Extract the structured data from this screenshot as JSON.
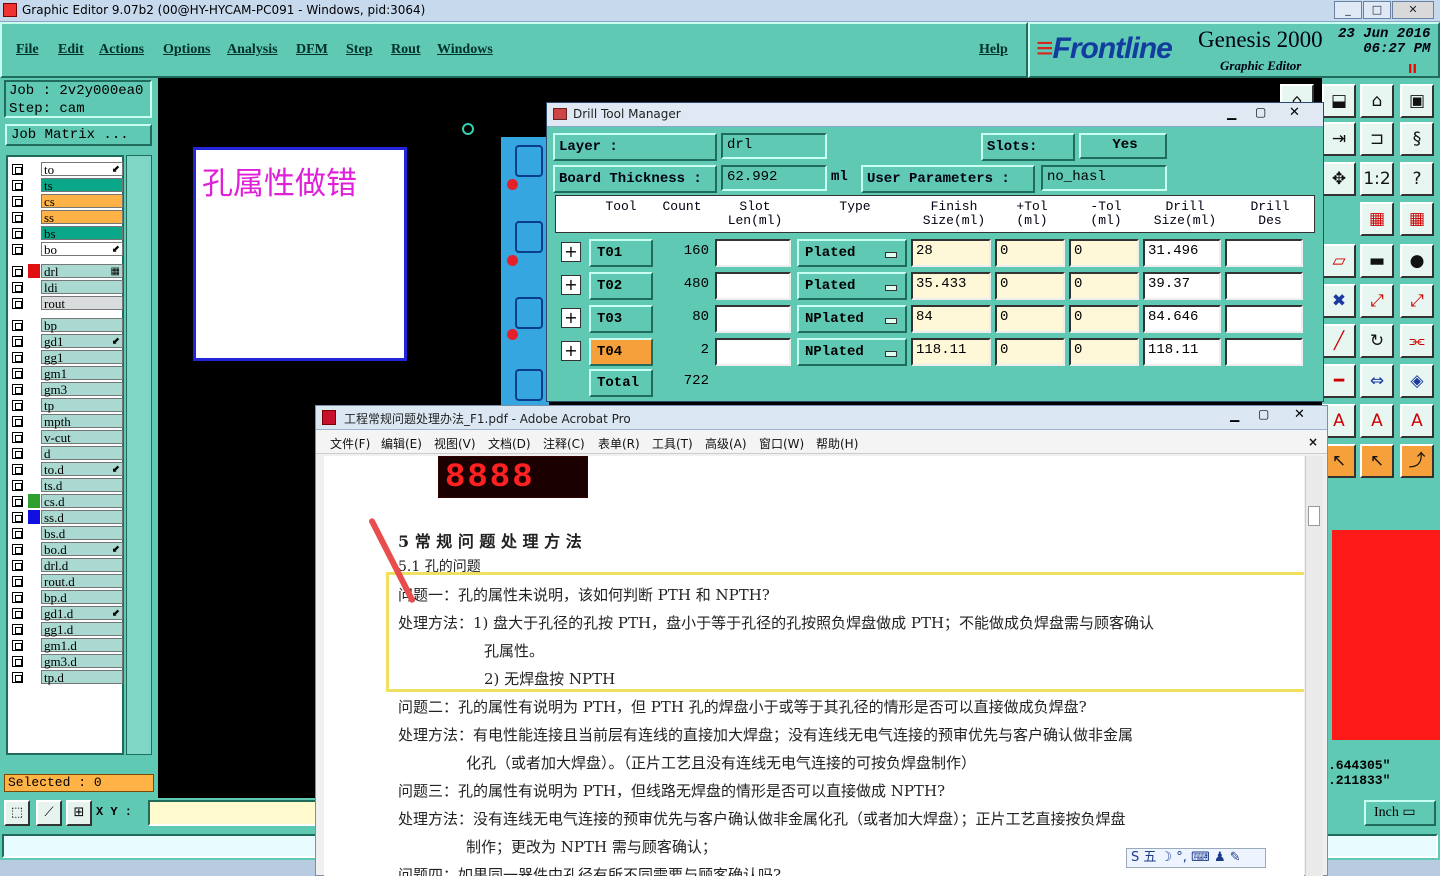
{
  "window": {
    "title": "Graphic Editor 9.07b2 (00@HY-HYCAM-PC091 - Windows, pid:3064)",
    "controls": [
      "_",
      "□",
      "✕"
    ]
  },
  "menu": [
    "File",
    "Edit",
    "Actions",
    "Options",
    "Analysis",
    "DFM",
    "Step",
    "Rout",
    "Windows"
  ],
  "help_label": "Help",
  "brand": {
    "logo": "Frontline",
    "product": "Genesis 2000",
    "subtitle": "Graphic Editor",
    "date": "23 Jun 2016",
    "time": "06:27 PM",
    "marker": "II"
  },
  "job": {
    "job_line": "Job : 2v2y000ea0",
    "step_line": "Step: cam",
    "matrix_button": "Job Matrix ..."
  },
  "layers": [
    {
      "name": "to",
      "color": "#ffffff",
      "mark": "⬋"
    },
    {
      "name": "ts",
      "color": "#0aa888",
      "mark": ""
    },
    {
      "name": "cs",
      "color": "#ffb347",
      "mark": ""
    },
    {
      "name": "ss",
      "color": "#ffb347",
      "mark": ""
    },
    {
      "name": "bs",
      "color": "#0aa888",
      "mark": ""
    },
    {
      "name": "bo",
      "color": "#ffffff",
      "mark": "⬋"
    },
    {
      "name": "drl",
      "color": "#a9d9d0",
      "mark": "▦",
      "swatch": "#e01010",
      "active": true
    },
    {
      "name": "ldi",
      "color": "#a9d9d0",
      "mark": ""
    },
    {
      "name": "rout",
      "color": "#d8dcdc",
      "mark": ""
    },
    {
      "name": "bp",
      "color": "#a9d9d0",
      "mark": ""
    },
    {
      "name": "gd1",
      "color": "#a9d9d0",
      "mark": "⬋"
    },
    {
      "name": "gg1",
      "color": "#a9d9d0",
      "mark": ""
    },
    {
      "name": "gm1",
      "color": "#a9d9d0",
      "mark": ""
    },
    {
      "name": "gm3",
      "color": "#a9d9d0",
      "mark": ""
    },
    {
      "name": "tp",
      "color": "#a9d9d0",
      "mark": ""
    },
    {
      "name": "mpth",
      "color": "#a9d9d0",
      "mark": ""
    },
    {
      "name": "v-cut",
      "color": "#a9d9d0",
      "mark": ""
    },
    {
      "name": "d",
      "color": "#a9d9d0",
      "mark": ""
    },
    {
      "name": "to.d",
      "color": "#a9d9d0",
      "mark": "⬋"
    },
    {
      "name": "ts.d",
      "color": "#a9d9d0",
      "mark": ""
    },
    {
      "name": "cs.d",
      "color": "#a9d9d0",
      "mark": "",
      "swatch": "#2fa02f"
    },
    {
      "name": "ss.d",
      "color": "#a9d9d0",
      "mark": "",
      "swatch": "#1010e0"
    },
    {
      "name": "bs.d",
      "color": "#a9d9d0",
      "mark": ""
    },
    {
      "name": "bo.d",
      "color": "#a9d9d0",
      "mark": "⬋"
    },
    {
      "name": "drl.d",
      "color": "#a9d9d0",
      "mark": ""
    },
    {
      "name": "rout.d",
      "color": "#a9d9d0",
      "mark": ""
    },
    {
      "name": "bp.d",
      "color": "#a9d9d0",
      "mark": ""
    },
    {
      "name": "gd1.d",
      "color": "#a9d9d0",
      "mark": "⬋"
    },
    {
      "name": "gg1.d",
      "color": "#a9d9d0",
      "mark": ""
    },
    {
      "name": "gm1.d",
      "color": "#a9d9d0",
      "mark": ""
    },
    {
      "name": "gm3.d",
      "color": "#a9d9d0",
      "mark": ""
    },
    {
      "name": "tp.d",
      "color": "#a9d9d0",
      "mark": ""
    }
  ],
  "selected_label": "Selected : 0",
  "canvas_note": "孔属性做错",
  "xy_label": "X Y :",
  "coords": {
    "x": ".644305\"",
    "y": ".211833\""
  },
  "units": "Inch",
  "drill_manager": {
    "title": "Drill Tool Manager",
    "layer_label": "Layer           :",
    "layer_value": "drl",
    "slots_label": "Slots:",
    "slots_value": "Yes",
    "board_label": "Board Thickness  :",
    "board_value": "62.992",
    "board_unit": "ml",
    "userparams_label": "User Parameters :",
    "userparams_value": "no_hasl",
    "headers": [
      "Tool",
      "Count",
      "Slot\nLen(ml)",
      "Type",
      "Finish\nSize(ml)",
      "+Tol\n(ml)",
      "-Tol\n(ml)",
      "Drill\nSize(ml)",
      "Drill\nDes"
    ],
    "rows": [
      {
        "tool": "T01",
        "count": "160",
        "slot": "",
        "type": "Plated",
        "finish": "28",
        "ptol": "0",
        "mtol": "0",
        "drill": "31.496",
        "des": ""
      },
      {
        "tool": "T02",
        "count": "480",
        "slot": "",
        "type": "Plated",
        "finish": "35.433",
        "ptol": "0",
        "mtol": "0",
        "drill": "39.37",
        "des": ""
      },
      {
        "tool": "T03",
        "count": "80",
        "slot": "",
        "type": "NPlated",
        "finish": "84",
        "ptol": "0",
        "mtol": "0",
        "drill": "84.646",
        "des": ""
      },
      {
        "tool": "T04",
        "count": "2",
        "slot": "",
        "type": "NPlated",
        "finish": "118.11",
        "ptol": "0",
        "mtol": "0",
        "drill": "118.11",
        "des": ""
      }
    ],
    "total_label": "Total",
    "total_value": "722"
  },
  "acrobat": {
    "title": "工程常规问题处理办法_F1.pdf - Adobe Acrobat Pro",
    "menu": [
      "文件(F)",
      "编辑(E)",
      "视图(V)",
      "文档(D)",
      "注释(C)",
      "表单(R)",
      "工具(T)",
      "高级(A)",
      "窗口(W)",
      "帮助(H)"
    ],
    "close": "×",
    "segment_display": "8888",
    "lines": [
      "5 常 规 问 题 处 理 方 法",
      "5.1  孔的问题",
      "问题一：孔的属性未说明，该如何判断 PTH 和 NPTH?",
      "处理方法：1) 盘大于孔径的孔按 PTH，盘小于等于孔径的孔按照负焊盘做成 PTH；不能做成负焊盘需与顾客确认",
      "孔属性。",
      "2) 无焊盘按 NPTH",
      "问题二：孔的属性有说明为 PTH，但 PTH 孔的焊盘小于或等于其孔径的情形是否可以直接做成负焊盘?",
      "处理方法：有电性能连接且当前层有连线的直接加大焊盘；没有连线无电气连接的预审优先与客户确认做非金属",
      "化孔（或者加大焊盘）。（正片工艺且没有连线无电气连接的可按负焊盘制作）",
      "问题三：孔的属性有说明为 PTH，但线路无焊盘的情形是否可以直接做成 NPTH?",
      "处理方法：没有连线无电气连接的预审优先与客户确认做非金属化孔（或者加大焊盘）；正片工艺直接按负焊盘",
      "制作；更改为 NPTH 需与顾客确认；",
      "问题四：如果同一器件中孔径有所不同需要与顾客确认吗?"
    ],
    "ime": "S 五 ☽ °, ⌨ ♟ ✎"
  }
}
